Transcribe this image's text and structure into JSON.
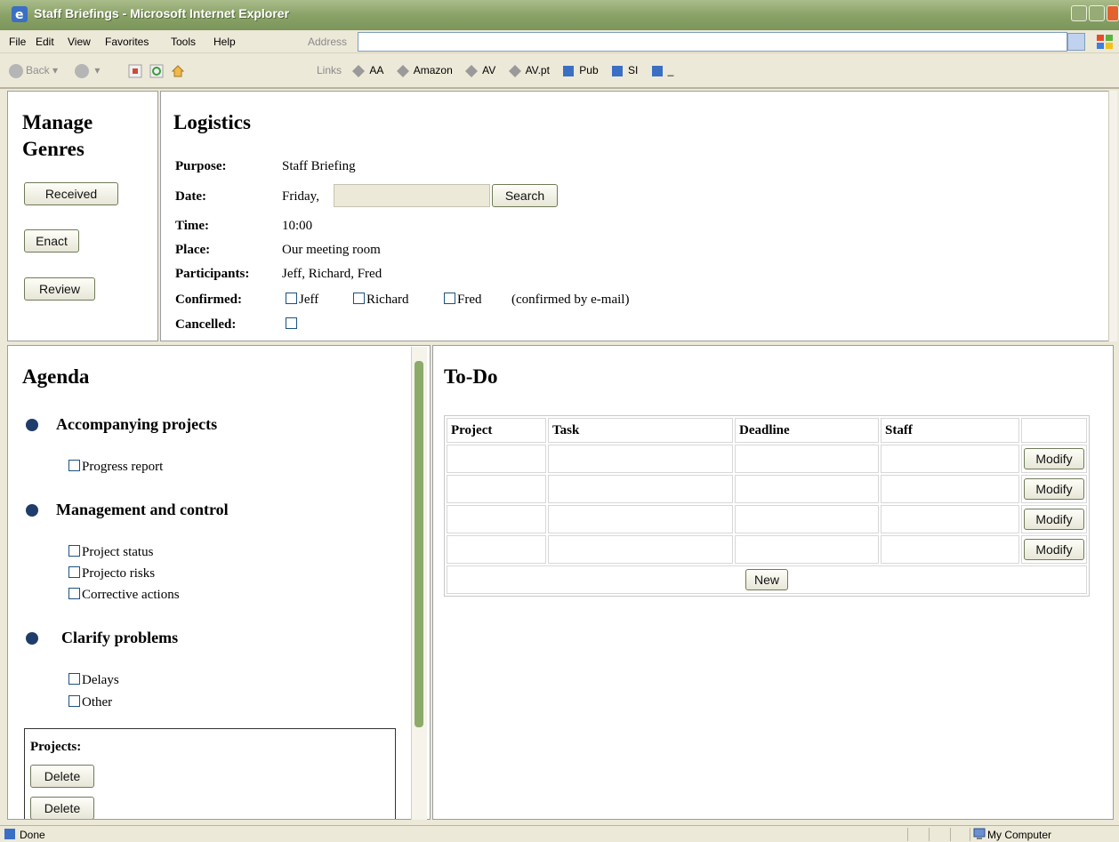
{
  "window": {
    "title": "Staff Briefings - Microsoft Internet Explorer"
  },
  "menu": {
    "items": [
      "File",
      "Edit",
      "View",
      "Favorites",
      "Tools",
      "Help"
    ],
    "address_label": "Address",
    "address_value": ""
  },
  "toolbar": {
    "back_label": "Back",
    "links_label": "Links",
    "links": [
      "AA",
      "Amazon",
      "AV",
      "AV.pt",
      "Pub",
      "SI",
      "_"
    ]
  },
  "genres": {
    "title_line1": "Manage",
    "title_line2": "Genres",
    "buttons": [
      "Received",
      "Enact",
      "Review"
    ]
  },
  "logistics": {
    "title": "Logistics",
    "purpose_label": "Purpose:",
    "purpose_value": "Staff Briefing",
    "date_label": "Date:",
    "date_prefix": "Friday,",
    "date_value": "",
    "search_label": "Search",
    "time_label": "Time:",
    "time_value": "10:00",
    "place_label": "Place:",
    "place_value": "Our meeting room",
    "participants_label": "Participants:",
    "participants_value": "Jeff, Richard, Fred",
    "confirmed_label": "Confirmed:",
    "confirmed_names": [
      "Jeff",
      "Richard",
      "Fred"
    ],
    "confirmed_note": "(confirmed by e-mail)",
    "cancelled_label": "Cancelled:"
  },
  "agenda": {
    "title": "Agenda",
    "sections": [
      {
        "heading": "Accompanying projects",
        "items": [
          "Progress report"
        ]
      },
      {
        "heading": "Management and control",
        "items": [
          "Project status",
          "Projecto risks",
          "Corrective actions"
        ]
      },
      {
        "heading": "Clarify problems",
        "items": [
          "Delays",
          "Other"
        ]
      }
    ],
    "projects_label": "Projects:",
    "delete_label": "Delete"
  },
  "todo": {
    "title": "To-Do",
    "columns": [
      "Project",
      "Task",
      "Deadline",
      "Staff",
      ""
    ],
    "modify_label": "Modify",
    "new_label": "New"
  },
  "status": {
    "text": "Done",
    "zone": "My Computer"
  },
  "colors": {
    "titlebar": "#8aa268",
    "bullet": "#1f3d6b",
    "scroll_thumb": "#8cab6b"
  }
}
